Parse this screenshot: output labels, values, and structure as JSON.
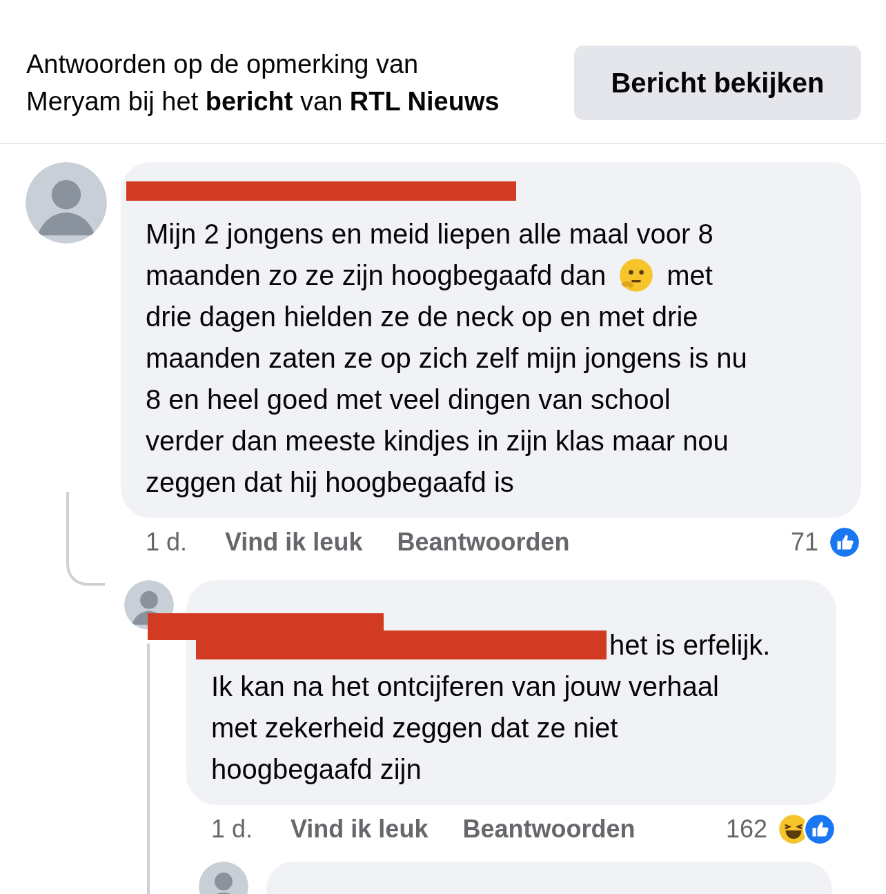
{
  "header": {
    "lines": [
      "Antwoorden op de opmerking van",
      "Meryam bij het **bericht** van **RTL Nieuws**"
    ],
    "button": "Bericht bekijken"
  },
  "comment": {
    "lines": [
      {
        "text": "Mijn 2 jongens en meid liepen alle maal voor 8"
      },
      {
        "text": "maanden zo ze zijn hoogbegaafd dan",
        "kind": "emoji",
        "text_after": "met"
      },
      {
        "text": "drie dagen hielden ze de neck op en met drie"
      },
      {
        "text": "maanden zaten ze op zich zelf mijn jongens is nu"
      },
      {
        "text": "8 en heel goed met veel dingen van school"
      },
      {
        "text": "verder dan meeste kindjes in zijn klas maar nou"
      },
      {
        "text": "zeggen dat hij hoogbegaafd is"
      }
    ],
    "time": "1 d.",
    "actions": [
      "Vind ik leuk",
      "Beantwoorden"
    ],
    "reaction_count": "71",
    "reactions": [
      {
        "kind": "like"
      }
    ]
  },
  "reply": {
    "lines": [
      {
        "text": "het is erfelijk.",
        "redacted": true
      },
      {
        "text": "Ik kan na het ontcijferen van jouw verhaal"
      },
      {
        "text": "met zekerheid zeggen dat ze niet"
      },
      {
        "text": "hoogbegaafd zijn"
      }
    ],
    "time": "1 d.",
    "actions": [
      "Vind ik leuk",
      "Beantwoorden"
    ],
    "reaction_count": "162",
    "reactions": [
      {
        "kind": "laugh"
      },
      {
        "kind": "like"
      }
    ]
  }
}
